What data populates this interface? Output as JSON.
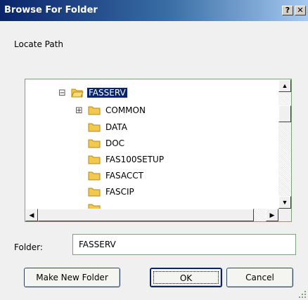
{
  "window": {
    "title": "Browse For Folder",
    "help_button": "?",
    "close_button": "✕"
  },
  "instruction": "Locate Path",
  "tree": {
    "items": [
      {
        "label": "FASSERV",
        "expander": "⊟",
        "selected": true,
        "level": 0
      },
      {
        "label": "COMMON",
        "expander": "⊞",
        "selected": false,
        "level": 1
      },
      {
        "label": "DATA",
        "expander": "",
        "selected": false,
        "level": 1
      },
      {
        "label": "DOC",
        "expander": "",
        "selected": false,
        "level": 1
      },
      {
        "label": "FAS100SETUP",
        "expander": "",
        "selected": false,
        "level": 1
      },
      {
        "label": "FASACCT",
        "expander": "",
        "selected": false,
        "level": 1
      },
      {
        "label": "FASCIP",
        "expander": "",
        "selected": false,
        "level": 1
      }
    ],
    "icon": "folder-icon",
    "folder_color": "#f2c94c"
  },
  "folder_field": {
    "label": "Folder:",
    "value": "FASSERV"
  },
  "buttons": {
    "make_new_folder": "Make New Folder",
    "ok": "OK",
    "cancel": "Cancel"
  },
  "colors": {
    "title_bar": "#0a246a",
    "selection": "#0a246a",
    "border_accent": "#7aa37a"
  }
}
